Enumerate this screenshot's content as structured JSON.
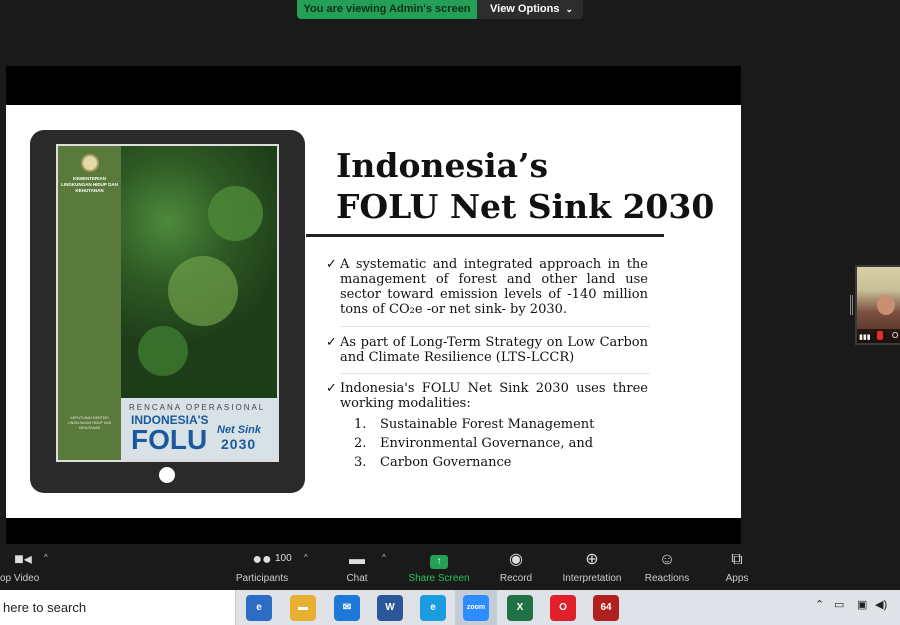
{
  "banner": {
    "viewing_text": "You are viewing Admin's screen",
    "view_options_label": "View Options",
    "accent": "#23a055"
  },
  "slide": {
    "title_line1": "Indonesia’s",
    "title_line2": "FOLU Net Sink 2030",
    "bullet1": "A systematic and integrated approach in the management of forest and other land use sector toward emission levels of -140 million tons of CO₂e -or net sink- by 2030.",
    "bullet2": "As part of Long-Term Strategy on Low Carbon and Climate Resilience (LTS-LCCR)",
    "bullet3": "Indonesia's FOLU Net Sink 2030 uses three working modalities:",
    "modalities": [
      {
        "num": "1.",
        "text": "Sustainable Forest Management"
      },
      {
        "num": "2.",
        "text": "Environmental Governance, and"
      },
      {
        "num": "3.",
        "text": "Carbon Governance"
      }
    ],
    "cover": {
      "ministry": "KEMENTERIAN LINGKUNGAN HIDUP DAN KEHUTANAN",
      "decree": "KEPUTUSAN MENTERI LINGKUNGAN HIDUP DAN KEHUTANAN",
      "subtitle": "RENCANA OPERASIONAL",
      "indonesia": "INDONESIA'S",
      "folu": "FOLU",
      "netsink": "Net Sink",
      "year": "2030"
    }
  },
  "participant_thumb": {
    "name_initial": "O"
  },
  "toolbar": {
    "video_label": "op Video",
    "participants_label": "Participants",
    "participants_count": "100",
    "chat_label": "Chat",
    "share_label": "Share Screen",
    "record_label": "Record",
    "interpretation_label": "Interpretation",
    "reactions_label": "Reactions",
    "apps_label": "Apps"
  },
  "taskbar": {
    "search_placeholder": "here to search",
    "apps": [
      {
        "name": "edge-legacy",
        "label": "e",
        "color": "#2b6cc4"
      },
      {
        "name": "file-explorer",
        "label": "▬",
        "color": "#e8b030"
      },
      {
        "name": "mail",
        "label": "✉",
        "color": "#1e78d7"
      },
      {
        "name": "word",
        "label": "W",
        "color": "#2b579a"
      },
      {
        "name": "edge",
        "label": "e",
        "color": "#1a9de0"
      },
      {
        "name": "zoom",
        "label": "zoom",
        "color": "#2d8cff"
      },
      {
        "name": "excel",
        "label": "X",
        "color": "#217346"
      },
      {
        "name": "opera",
        "label": "O",
        "color": "#e0202a"
      },
      {
        "name": "game",
        "label": "64",
        "color": "#b02020"
      }
    ]
  }
}
